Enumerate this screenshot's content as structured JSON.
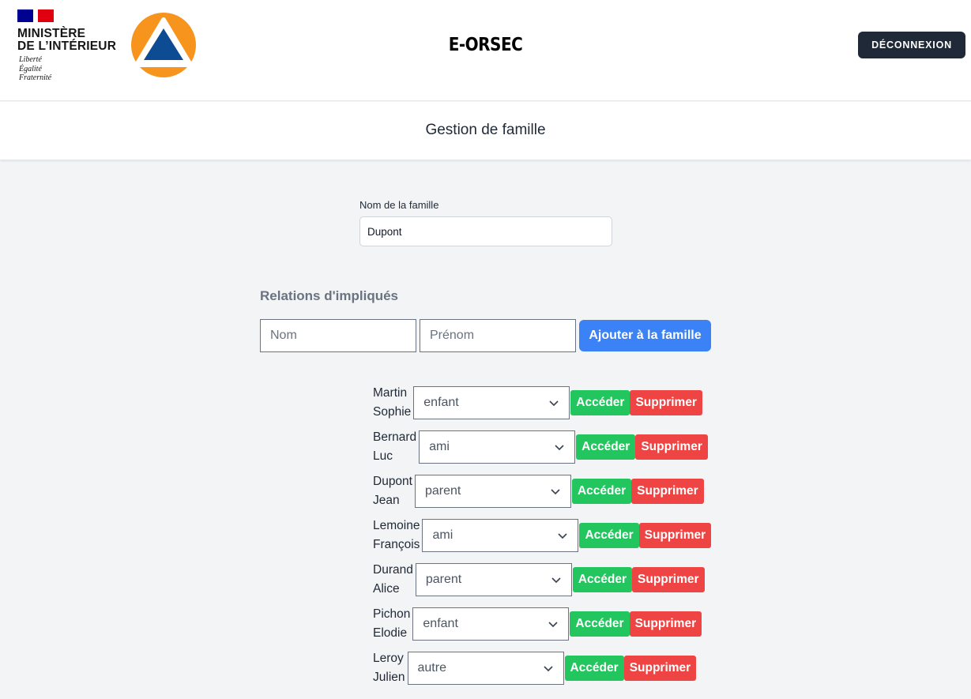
{
  "header": {
    "ministry_line1": "MINISTÈRE",
    "ministry_line2": "DE L’INTÉRIEUR",
    "motto": [
      "Liberté",
      "Égalité",
      "Fraternité"
    ],
    "app_title": "E-ORSEC",
    "logout_label": "DÉCONNEXION",
    "logo_icon": "civil-protection-triangle-icon",
    "colors": {
      "logo_orange": "#f7941d",
      "logo_blue": "#0d4c93",
      "flag_blue": "#000091",
      "flag_red": "#e1000f"
    }
  },
  "page": {
    "title": "Gestion de famille"
  },
  "family": {
    "label": "Nom de la famille",
    "value": "Dupont"
  },
  "relations": {
    "title": "Relations d'impliqués",
    "nom_placeholder": "Nom",
    "prenom_placeholder": "Prénom",
    "add_label": "Ajouter à la famille",
    "access_label": "Accéder",
    "delete_label": "Supprimer",
    "items": [
      {
        "nom": "Martin",
        "prenom": "Sophie",
        "relation": "enfant"
      },
      {
        "nom": "Bernard",
        "prenom": "Luc",
        "relation": "ami"
      },
      {
        "nom": "Dupont",
        "prenom": "Jean",
        "relation": "parent"
      },
      {
        "nom": "Lemoine",
        "prenom": "François",
        "relation": "ami"
      },
      {
        "nom": "Durand",
        "prenom": "Alice",
        "relation": "parent"
      },
      {
        "nom": "Pichon",
        "prenom": "Elodie",
        "relation": "enfant"
      },
      {
        "nom": "Leroy",
        "prenom": "Julien",
        "relation": "autre"
      }
    ]
  },
  "colors": {
    "accent_blue": "#3b82f6",
    "success_green": "#22c55e",
    "danger_red": "#ef4444",
    "dark_button": "#1f2937"
  }
}
